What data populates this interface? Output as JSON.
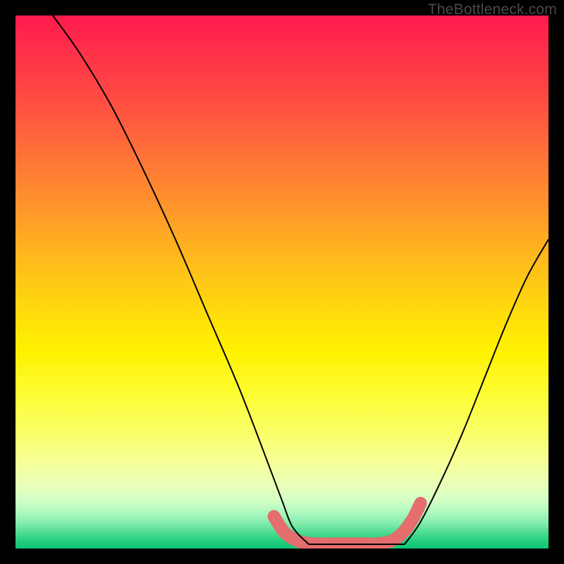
{
  "watermark": "TheBottleneck.com",
  "chart_data": {
    "type": "line",
    "title": "",
    "xlabel": "",
    "ylabel": "",
    "xlim": [
      0,
      100
    ],
    "ylim": [
      0,
      100
    ],
    "grid": false,
    "series": [
      {
        "name": "left-curve",
        "color": "#000000",
        "x": [
          7,
          12,
          18,
          24,
          30,
          36,
          42,
          47,
          50,
          52,
          55
        ],
        "y": [
          100,
          93,
          83,
          71,
          58,
          44,
          30,
          17,
          9,
          4,
          0.8
        ]
      },
      {
        "name": "right-curve",
        "color": "#000000",
        "x": [
          73,
          76,
          80,
          84,
          88,
          92,
          96,
          100
        ],
        "y": [
          0.8,
          5,
          13,
          22,
          32,
          42,
          51,
          58
        ]
      },
      {
        "name": "bottom-flat",
        "color": "#000000",
        "x": [
          55,
          60,
          65,
          70,
          73
        ],
        "y": [
          0.8,
          0.8,
          0.8,
          0.8,
          0.8
        ]
      },
      {
        "name": "salmon-overlay",
        "color": "#e46d6d",
        "points": [
          {
            "x": 48.5,
            "y": 6.0,
            "r": 9
          },
          {
            "x": 50.5,
            "y": 3.0,
            "r": 9
          },
          {
            "x": 53.0,
            "y": 1.4,
            "r": 9
          },
          {
            "x": 56.0,
            "y": 0.9,
            "r": 9
          },
          {
            "x": 59.0,
            "y": 0.9,
            "r": 9
          },
          {
            "x": 62.0,
            "y": 0.9,
            "r": 9
          },
          {
            "x": 65.0,
            "y": 0.9,
            "r": 9
          },
          {
            "x": 68.0,
            "y": 0.9,
            "r": 9
          },
          {
            "x": 70.5,
            "y": 1.4,
            "r": 9
          },
          {
            "x": 72.5,
            "y": 2.8,
            "r": 9
          },
          {
            "x": 74.5,
            "y": 5.5,
            "r": 9
          },
          {
            "x": 76.0,
            "y": 8.5,
            "r": 9
          }
        ]
      }
    ],
    "background_gradient": {
      "top": "#ff1a4d",
      "mid": "#fff200",
      "bottom": "#0fc877"
    }
  }
}
